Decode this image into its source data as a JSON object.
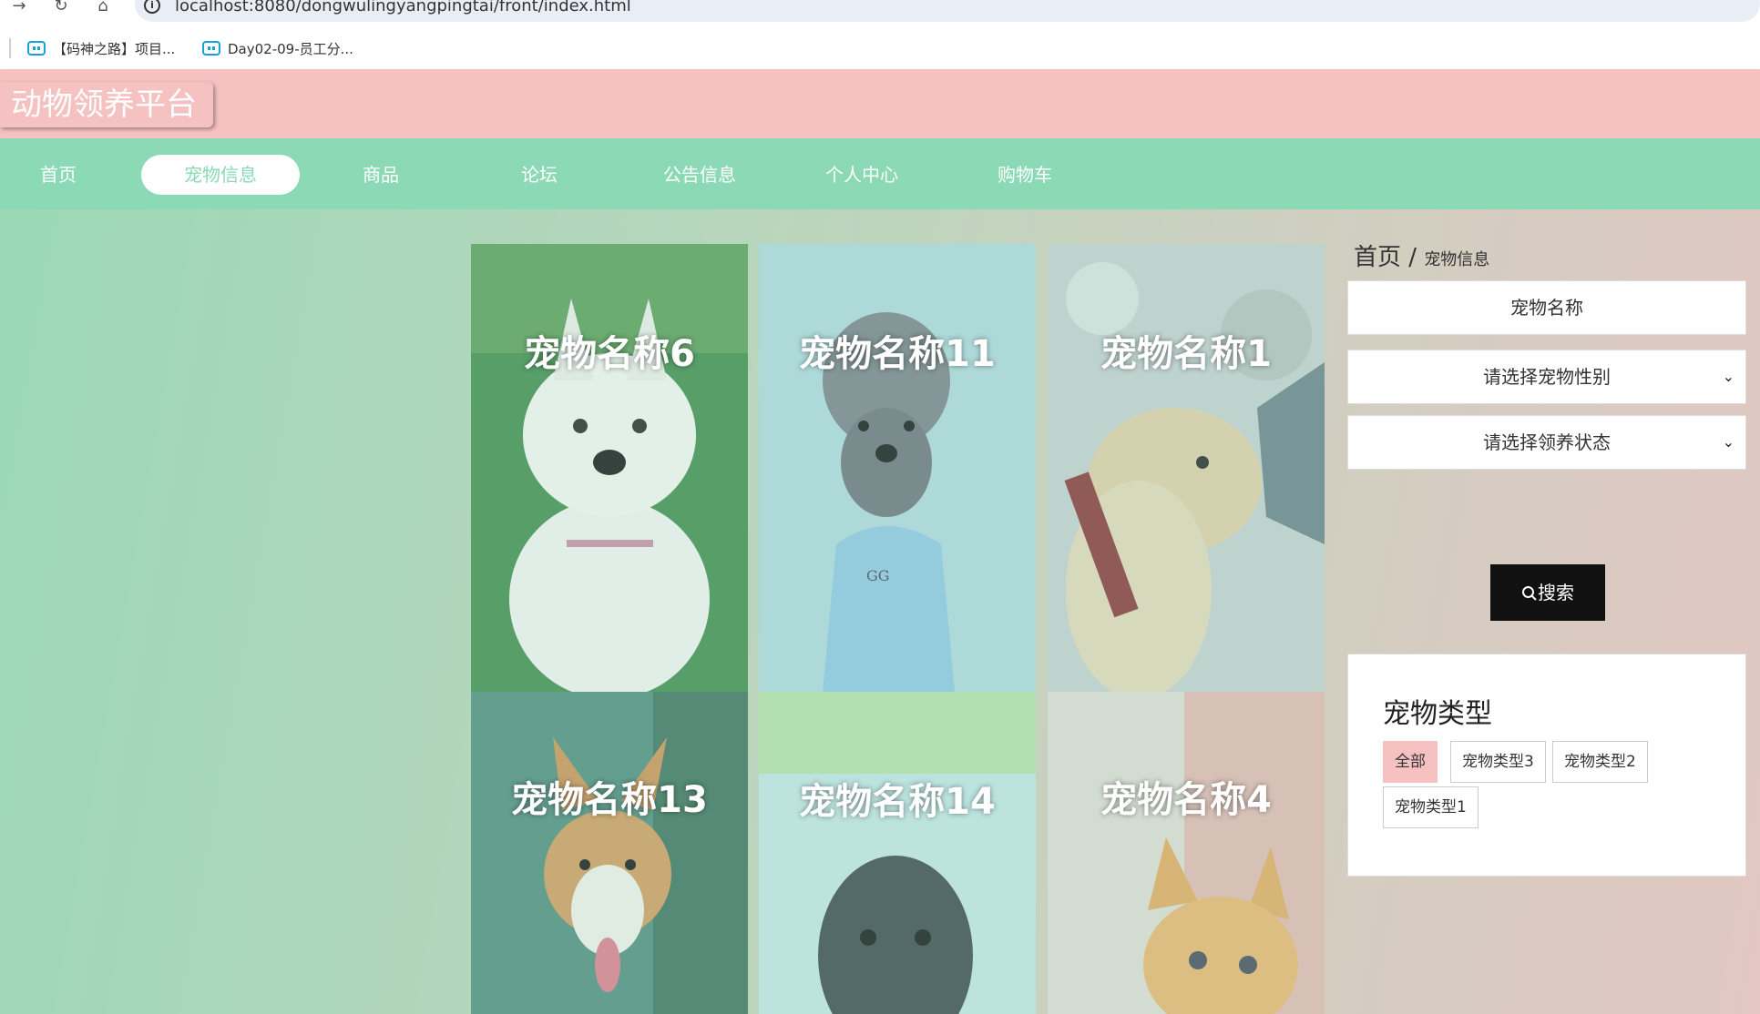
{
  "browser": {
    "url": "localhost:8080/dongwulingyangpingtai/front/index.html",
    "bookmarks": [
      "【码神之路】项目...",
      "Day02-09-员工分..."
    ]
  },
  "header": {
    "site_title": "动物领养平台"
  },
  "nav": {
    "items": [
      "首页",
      "宠物信息",
      "商品",
      "论坛",
      "公告信息",
      "个人中心",
      "购物车"
    ],
    "active": "宠物信息"
  },
  "pets": [
    {
      "name": "宠物名称6",
      "image": "westie-dog"
    },
    {
      "name": "宠物名称11",
      "image": "poodle-dog"
    },
    {
      "name": "宠物名称1",
      "image": "golden-dog"
    },
    {
      "name": "宠物名称13",
      "image": "corgi-dog"
    },
    {
      "name": "宠物名称14",
      "image": "pug-dog"
    },
    {
      "name": "宠物名称4",
      "image": "orange-kitten"
    }
  ],
  "sidebar": {
    "breadcrumb": {
      "home": "首页",
      "sep": "/",
      "current": "宠物信息"
    },
    "search": {
      "name_placeholder": "宠物名称",
      "gender_select": "请选择宠物性别",
      "status_select": "请选择领养状态",
      "button_label": "搜索"
    },
    "types": {
      "title": "宠物类型",
      "tags": [
        "全部",
        "宠物类型3",
        "宠物类型2",
        "宠物类型1"
      ],
      "active": "全部"
    }
  },
  "colors": {
    "header": "#f5c1c1",
    "nav": "#8cd9b5",
    "search_button": "#111111"
  }
}
